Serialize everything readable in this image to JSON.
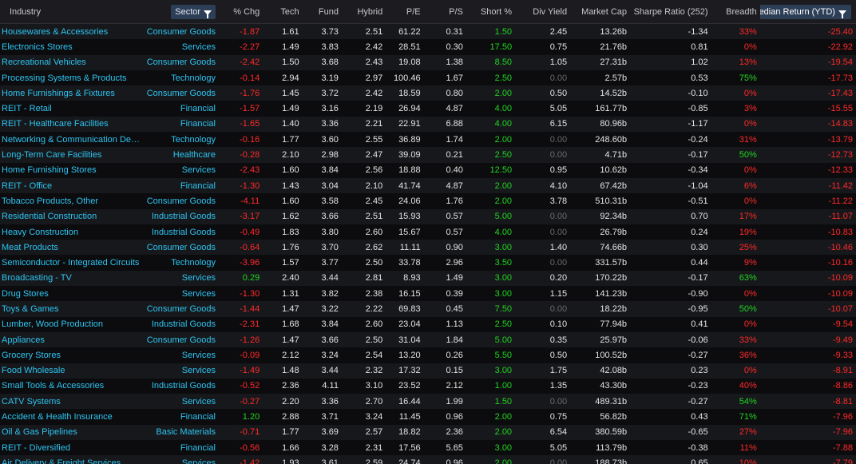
{
  "colors": {
    "background": "#0b0b0d",
    "row_even": "#16181b",
    "link": "#2ec4f1",
    "positive": "#21d421",
    "negative": "#ff2a2a",
    "neutral_zero": "#6a6a6a",
    "active_header": "#2d3e57"
  },
  "icons": {
    "sector_filter": "filter-icon",
    "median_filter": "filter-icon"
  },
  "headers": {
    "industry": "Industry",
    "sector": "Sector",
    "chg": "% Chg",
    "tech": "Tech",
    "fund": "Fund",
    "hybrid": "Hybrid",
    "pe": "P/E",
    "ps": "P/S",
    "short": "Short %",
    "div": "Div Yield",
    "mcap": "Market Cap",
    "sharpe": "Sharpe Ratio (252)",
    "breadth": "Breadth",
    "median": "Median Return (YTD)"
  },
  "rows": [
    {
      "industry": "Housewares & Accessories",
      "sector": "Consumer Goods",
      "chg": "-1.87",
      "tech": "1.61",
      "fund": "3.73",
      "hybrid": "2.51",
      "pe": "61.22",
      "ps": "0.31",
      "short": "1.50",
      "div": "2.45",
      "mcap": "13.26b",
      "sharpe": "-1.34",
      "breadth": "33%",
      "median": "-25.40"
    },
    {
      "industry": "Electronics Stores",
      "sector": "Services",
      "chg": "-2.27",
      "tech": "1.49",
      "fund": "3.83",
      "hybrid": "2.42",
      "pe": "28.51",
      "ps": "0.30",
      "short": "17.50",
      "div": "0.75",
      "mcap": "21.76b",
      "sharpe": "0.81",
      "breadth": "0%",
      "median": "-22.92"
    },
    {
      "industry": "Recreational Vehicles",
      "sector": "Consumer Goods",
      "chg": "-2.42",
      "tech": "1.50",
      "fund": "3.68",
      "hybrid": "2.43",
      "pe": "19.08",
      "ps": "1.38",
      "short": "8.50",
      "div": "1.05",
      "mcap": "27.31b",
      "sharpe": "1.02",
      "breadth": "13%",
      "median": "-19.54"
    },
    {
      "industry": "Processing Systems & Products",
      "sector": "Technology",
      "chg": "-0.14",
      "tech": "2.94",
      "fund": "3.19",
      "hybrid": "2.97",
      "pe": "100.46",
      "ps": "1.67",
      "short": "2.50",
      "div": "0.00",
      "mcap": "2.57b",
      "sharpe": "0.53",
      "breadth": "75%",
      "median": "-17.73"
    },
    {
      "industry": "Home Furnishings & Fixtures",
      "sector": "Consumer Goods",
      "chg": "-1.76",
      "tech": "1.45",
      "fund": "3.72",
      "hybrid": "2.42",
      "pe": "18.59",
      "ps": "0.80",
      "short": "2.00",
      "div": "0.50",
      "mcap": "14.52b",
      "sharpe": "-0.10",
      "breadth": "0%",
      "median": "-17.43"
    },
    {
      "industry": "REIT - Retail",
      "sector": "Financial",
      "chg": "-1.57",
      "tech": "1.49",
      "fund": "3.16",
      "hybrid": "2.19",
      "pe": "26.94",
      "ps": "4.87",
      "short": "4.00",
      "div": "5.05",
      "mcap": "161.77b",
      "sharpe": "-0.85",
      "breadth": "3%",
      "median": "-15.55"
    },
    {
      "industry": "REIT - Healthcare Facilities",
      "sector": "Financial",
      "chg": "-1.65",
      "tech": "1.40",
      "fund": "3.36",
      "hybrid": "2.21",
      "pe": "22.91",
      "ps": "6.88",
      "short": "4.00",
      "div": "6.15",
      "mcap": "80.96b",
      "sharpe": "-1.17",
      "breadth": "0%",
      "median": "-14.83"
    },
    {
      "industry": "Networking & Communication Devi...",
      "sector": "Technology",
      "chg": "-0.16",
      "tech": "1.77",
      "fund": "3.60",
      "hybrid": "2.55",
      "pe": "36.89",
      "ps": "1.74",
      "short": "2.00",
      "div": "0.00",
      "mcap": "248.60b",
      "sharpe": "-0.24",
      "breadth": "31%",
      "median": "-13.79"
    },
    {
      "industry": "Long-Term Care Facilities",
      "sector": "Healthcare",
      "chg": "-0.28",
      "tech": "2.10",
      "fund": "2.98",
      "hybrid": "2.47",
      "pe": "39.09",
      "ps": "0.21",
      "short": "2.50",
      "div": "0.00",
      "mcap": "4.71b",
      "sharpe": "-0.17",
      "breadth": "50%",
      "median": "-12.73"
    },
    {
      "industry": "Home Furnishing Stores",
      "sector": "Services",
      "chg": "-2.43",
      "tech": "1.60",
      "fund": "3.84",
      "hybrid": "2.56",
      "pe": "18.88",
      "ps": "0.40",
      "short": "12.50",
      "div": "0.95",
      "mcap": "10.62b",
      "sharpe": "-0.34",
      "breadth": "0%",
      "median": "-12.33"
    },
    {
      "industry": "REIT - Office",
      "sector": "Financial",
      "chg": "-1.30",
      "tech": "1.43",
      "fund": "3.04",
      "hybrid": "2.10",
      "pe": "41.74",
      "ps": "4.87",
      "short": "2.00",
      "div": "4.10",
      "mcap": "67.42b",
      "sharpe": "-1.04",
      "breadth": "6%",
      "median": "-11.42"
    },
    {
      "industry": "Tobacco Products, Other",
      "sector": "Consumer Goods",
      "chg": "-4.11",
      "tech": "1.60",
      "fund": "3.58",
      "hybrid": "2.45",
      "pe": "24.06",
      "ps": "1.76",
      "short": "2.00",
      "div": "3.78",
      "mcap": "510.31b",
      "sharpe": "-0.51",
      "breadth": "0%",
      "median": "-11.22"
    },
    {
      "industry": "Residential Construction",
      "sector": "Industrial Goods",
      "chg": "-3.17",
      "tech": "1.62",
      "fund": "3.66",
      "hybrid": "2.51",
      "pe": "15.93",
      "ps": "0.57",
      "short": "5.00",
      "div": "0.00",
      "mcap": "92.34b",
      "sharpe": "0.70",
      "breadth": "17%",
      "median": "-11.07"
    },
    {
      "industry": "Heavy Construction",
      "sector": "Industrial Goods",
      "chg": "-0.49",
      "tech": "1.83",
      "fund": "3.80",
      "hybrid": "2.60",
      "pe": "15.67",
      "ps": "0.57",
      "short": "4.00",
      "div": "0.00",
      "mcap": "26.79b",
      "sharpe": "0.24",
      "breadth": "19%",
      "median": "-10.83"
    },
    {
      "industry": "Meat Products",
      "sector": "Consumer Goods",
      "chg": "-0.64",
      "tech": "1.76",
      "fund": "3.70",
      "hybrid": "2.62",
      "pe": "11.11",
      "ps": "0.90",
      "short": "3.00",
      "div": "1.40",
      "mcap": "74.66b",
      "sharpe": "0.30",
      "breadth": "25%",
      "median": "-10.46"
    },
    {
      "industry": "Semiconductor - Integrated Circuits",
      "sector": "Technology",
      "chg": "-3.96",
      "tech": "1.57",
      "fund": "3.77",
      "hybrid": "2.50",
      "pe": "33.78",
      "ps": "2.96",
      "short": "3.50",
      "div": "0.00",
      "mcap": "331.57b",
      "sharpe": "0.44",
      "breadth": "9%",
      "median": "-10.16"
    },
    {
      "industry": "Broadcasting - TV",
      "sector": "Services",
      "chg": "0.29",
      "tech": "2.40",
      "fund": "3.44",
      "hybrid": "2.81",
      "pe": "8.93",
      "ps": "1.49",
      "short": "3.00",
      "div": "0.20",
      "mcap": "170.22b",
      "sharpe": "-0.17",
      "breadth": "63%",
      "median": "-10.09"
    },
    {
      "industry": "Drug Stores",
      "sector": "Services",
      "chg": "-1.30",
      "tech": "1.31",
      "fund": "3.82",
      "hybrid": "2.38",
      "pe": "16.15",
      "ps": "0.39",
      "short": "3.00",
      "div": "1.15",
      "mcap": "141.23b",
      "sharpe": "-0.90",
      "breadth": "0%",
      "median": "-10.09"
    },
    {
      "industry": "Toys & Games",
      "sector": "Consumer Goods",
      "chg": "-1.44",
      "tech": "1.47",
      "fund": "3.22",
      "hybrid": "2.22",
      "pe": "69.83",
      "ps": "0.45",
      "short": "7.50",
      "div": "0.00",
      "mcap": "18.22b",
      "sharpe": "-0.95",
      "breadth": "50%",
      "median": "-10.07"
    },
    {
      "industry": "Lumber, Wood Production",
      "sector": "Industrial Goods",
      "chg": "-2.31",
      "tech": "1.68",
      "fund": "3.84",
      "hybrid": "2.60",
      "pe": "23.04",
      "ps": "1.13",
      "short": "2.50",
      "div": "0.10",
      "mcap": "77.94b",
      "sharpe": "0.41",
      "breadth": "0%",
      "median": "-9.54"
    },
    {
      "industry": "Appliances",
      "sector": "Consumer Goods",
      "chg": "-1.26",
      "tech": "1.47",
      "fund": "3.66",
      "hybrid": "2.50",
      "pe": "31.04",
      "ps": "1.84",
      "short": "5.00",
      "div": "0.35",
      "mcap": "25.97b",
      "sharpe": "-0.06",
      "breadth": "33%",
      "median": "-9.49"
    },
    {
      "industry": "Grocery Stores",
      "sector": "Services",
      "chg": "-0.09",
      "tech": "2.12",
      "fund": "3.24",
      "hybrid": "2.54",
      "pe": "13.20",
      "ps": "0.26",
      "short": "5.50",
      "div": "0.50",
      "mcap": "100.52b",
      "sharpe": "-0.27",
      "breadth": "36%",
      "median": "-9.33"
    },
    {
      "industry": "Food Wholesale",
      "sector": "Services",
      "chg": "-1.49",
      "tech": "1.48",
      "fund": "3.44",
      "hybrid": "2.32",
      "pe": "17.32",
      "ps": "0.15",
      "short": "3.00",
      "div": "1.75",
      "mcap": "42.08b",
      "sharpe": "0.23",
      "breadth": "0%",
      "median": "-8.91"
    },
    {
      "industry": "Small Tools & Accessories",
      "sector": "Industrial Goods",
      "chg": "-0.52",
      "tech": "2.36",
      "fund": "4.11",
      "hybrid": "3.10",
      "pe": "23.52",
      "ps": "2.12",
      "short": "1.00",
      "div": "1.35",
      "mcap": "43.30b",
      "sharpe": "-0.23",
      "breadth": "40%",
      "median": "-8.86"
    },
    {
      "industry": "CATV Systems",
      "sector": "Services",
      "chg": "-0.27",
      "tech": "2.20",
      "fund": "3.36",
      "hybrid": "2.70",
      "pe": "16.44",
      "ps": "1.99",
      "short": "1.50",
      "div": "0.00",
      "mcap": "489.31b",
      "sharpe": "-0.27",
      "breadth": "54%",
      "median": "-8.81"
    },
    {
      "industry": "Accident & Health Insurance",
      "sector": "Financial",
      "chg": "1.20",
      "tech": "2.88",
      "fund": "3.71",
      "hybrid": "3.24",
      "pe": "11.45",
      "ps": "0.96",
      "short": "2.00",
      "div": "0.75",
      "mcap": "56.82b",
      "sharpe": "0.43",
      "breadth": "71%",
      "median": "-7.96"
    },
    {
      "industry": "Oil & Gas Pipelines",
      "sector": "Basic Materials",
      "chg": "-0.71",
      "tech": "1.77",
      "fund": "3.69",
      "hybrid": "2.57",
      "pe": "18.82",
      "ps": "2.36",
      "short": "2.00",
      "div": "6.54",
      "mcap": "380.59b",
      "sharpe": "-0.65",
      "breadth": "27%",
      "median": "-7.96"
    },
    {
      "industry": "REIT - Diversified",
      "sector": "Financial",
      "chg": "-0.56",
      "tech": "1.66",
      "fund": "3.28",
      "hybrid": "2.31",
      "pe": "17.56",
      "ps": "5.65",
      "short": "3.00",
      "div": "5.05",
      "mcap": "113.79b",
      "sharpe": "-0.38",
      "breadth": "11%",
      "median": "-7.88"
    },
    {
      "industry": "Air Delivery & Freight Services",
      "sector": "Services",
      "chg": "-1.42",
      "tech": "1.93",
      "fund": "3.61",
      "hybrid": "2.59",
      "pe": "24.74",
      "ps": "0.96",
      "short": "2.00",
      "div": "0.00",
      "mcap": "188.73b",
      "sharpe": "0.65",
      "breadth": "10%",
      "median": "-7.79"
    }
  ]
}
